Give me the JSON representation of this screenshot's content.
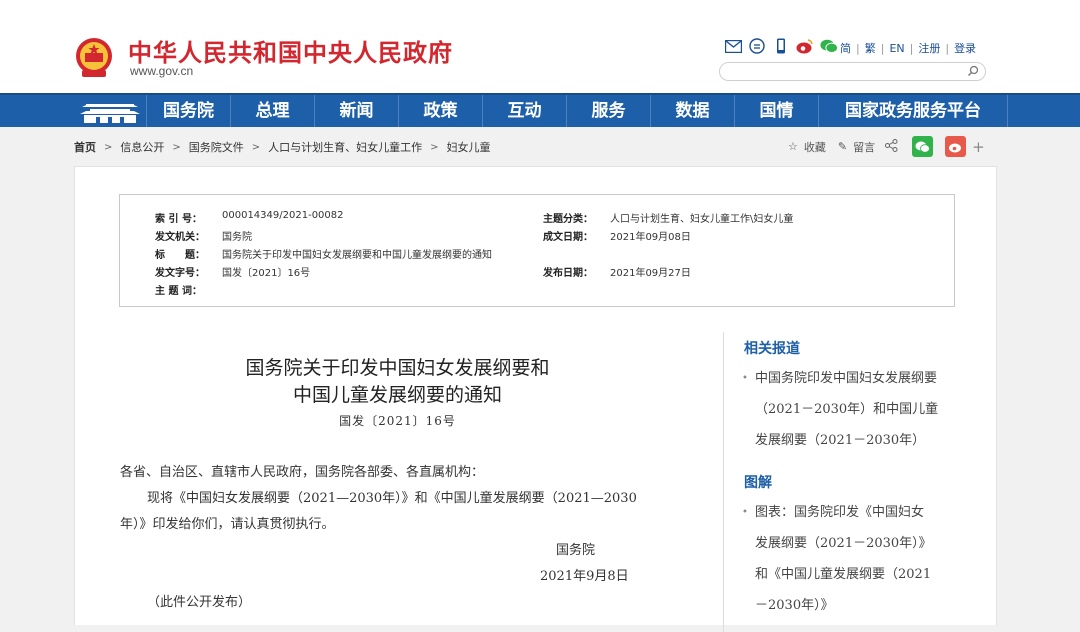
{
  "header": {
    "site_name": "中华人民共和国中央人民政府",
    "site_url": "www.gov.cn",
    "lang_links": [
      "简",
      "繁",
      "EN",
      "注册",
      "登录"
    ],
    "search_placeholder": ""
  },
  "nav": {
    "items": [
      "国务院",
      "总理",
      "新闻",
      "政策",
      "互动",
      "服务",
      "数据",
      "国情",
      "国家政务服务平台"
    ]
  },
  "breadcrumb": [
    "首页",
    "信息公开",
    "国务院文件",
    "人口与计划生育、妇女儿童工作",
    "妇女儿童"
  ],
  "share": {
    "favorite": "收藏",
    "comment": "留言"
  },
  "meta": {
    "index_label": "索 引 号：",
    "index": "000014349/2021-00082",
    "category_label": "主题分类：",
    "category": "人口与计划生育、妇女儿童工作\\妇女儿童",
    "issuer_label": "发文机关：",
    "issuer": "国务院",
    "written_label": "成文日期：",
    "written": "2021年09月08日",
    "title_label": "标　　题：",
    "title": "国务院关于印发中国妇女发展纲要和中国儿童发展纲要的通知",
    "docno_label": "发文字号：",
    "docno": "国发〔2021〕16号",
    "published_label": "发布日期：",
    "published": "2021年09月27日",
    "keywords_label": "主 题 词：",
    "keywords": ""
  },
  "article": {
    "title_line1": "国务院关于印发中国妇女发展纲要和",
    "title_line2": "中国儿童发展纲要的通知",
    "doc_number": "国发〔2021〕16号",
    "salutation": "各省、自治区、直辖市人民政府，国务院各部委、各直属机构：",
    "para1_a": "现将《中国妇女发展纲要（2021—2030年）》和《中国儿童发展纲要（2021—2030",
    "para1_b": "年）》印发给你们，请认真贯彻执行。",
    "signer": "国务院",
    "date": "2021年9月8日",
    "note": "（此件公开发布）"
  },
  "sidebar": {
    "related_heading": "相关报道",
    "related_lines": [
      "中国务院印发中国妇女发展纲要",
      "（2021－2030年）和中国儿童",
      "发展纲要（2021－2030年）"
    ],
    "graphic_heading": "图解",
    "graphic_lines": [
      "图表：国务院印发《中国妇女",
      "发展纲要（2021－2030年）》",
      "和《中国儿童发展纲要（2021",
      "－2030年）》"
    ]
  },
  "colors": {
    "brand_red": "#d3272f",
    "nav_blue": "#1d5fa8",
    "link_blue": "#1a4f95"
  }
}
